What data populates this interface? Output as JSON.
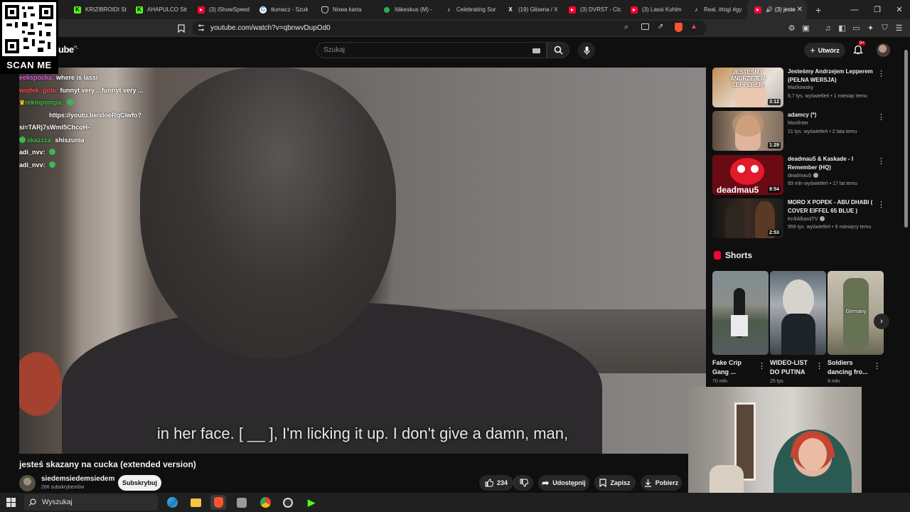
{
  "tabs": [
    {
      "label": "KRIZIBROIDI St",
      "color": "#53fc18"
    },
    {
      "label": "AHAPULCO Str",
      "color": "#53fc18"
    },
    {
      "label": "(3) iShowSpeed",
      "color": "#ff0033"
    },
    {
      "label": "tłumacz - Szuk",
      "color": "#dddddd"
    },
    {
      "label": "Nowa karta",
      "color": "#dddddd"
    },
    {
      "label": "Itäkeskus (M) -",
      "color": "#34a853"
    },
    {
      "label": "Celebrating Sor",
      "color": "#dddddd"
    },
    {
      "label": "(19) Główna / X",
      "color": "#dddddd"
    },
    {
      "label": "(3) DVRST - Clc",
      "color": "#ff0033"
    },
    {
      "label": "(3) Lassi Kuhlm",
      "color": "#ff0033"
    },
    {
      "label": "Real. #togi #gy",
      "color": "#dddddd"
    },
    {
      "label": "(3) jeste",
      "color": "#ff0033"
    }
  ],
  "address": {
    "url": "youtube.com/watch?v=qbnwvDupOd0"
  },
  "qr": {
    "label": "SCAN ME"
  },
  "header": {
    "logo": "ube",
    "region": "PL",
    "search_placeholder": "Szukaj",
    "create_label": "Utwórz",
    "notif_count": "9+"
  },
  "chat": [
    {
      "user": "eekspocka:",
      "text": "where is lassi",
      "color": "#e05bd9"
    },
    {
      "user": "wojtek_gola:",
      "text": "funnyt very ...funnyt very ...",
      "color": "#ff4a4a"
    },
    {
      "user": "rekinpompa:",
      "text": "",
      "color": "#41c440"
    },
    {
      "user": "",
      "text": "https://youtu.be/xloeRqCiwfo?",
      "color": "#ffffff"
    },
    {
      "user": "",
      "text": "si=TARj7sWmI5ChcoH-",
      "color": "#ffffff"
    },
    {
      "user": "skazzza:",
      "text": "shiszunia",
      "color": "#41c440"
    },
    {
      "user": "adi_nvv:",
      "text": "",
      "color": "#ffffff"
    },
    {
      "user": "adi_nvv:",
      "text": "",
      "color": "#ffffff"
    }
  ],
  "video": {
    "subtitle": "in her face. [ __ ], I'm licking it up. I don't give a damn, man,",
    "title": "jesteś skazany na cucka (extended version)"
  },
  "channel": {
    "name": "siedemsiedemsiedem",
    "subs": "266 subskrybentów",
    "subscribe_label": "Subskrybuj"
  },
  "actions": {
    "likes": "234",
    "share": "Udostępnij",
    "save": "Zapisz",
    "download": "Pobierz"
  },
  "recommendations": [
    {
      "title": "Jesteśmy Andrzejem Lepperem (PEŁNA WERSJA)",
      "channel": "Maćkowsky",
      "meta": "6,7 tys. wyświetleń • 1 miesiąc temu",
      "duration": "3:12",
      "verified": false,
      "thumb_text": "JESTEŚMY ANDRZEJEM LEPPEREM"
    },
    {
      "title": "adamcy (*)",
      "channel": "Monfinter",
      "meta": "21 tys. wyświetleń • 2 lata temu",
      "duration": "1:29",
      "verified": false
    },
    {
      "title": "deadmau5 & Kaskade - I Remember (HQ)",
      "channel": "deadmau5",
      "meta": "93 mln wyświetleń • 17 lat temu",
      "duration": "9:54",
      "verified": true,
      "thumb_text": "deadmau5"
    },
    {
      "title": "MORO X POPEK - ABU DHABI ( COVER EIFFEL 65 BLUE )",
      "channel": "KrólAlbaniiTV",
      "meta": "959 tys. wyświetleń • 9 miesięcy temu",
      "duration": "2:53",
      "verified": true
    }
  ],
  "shorts": {
    "heading": "Shorts",
    "items": [
      {
        "title": "Fake Crip Gang ...",
        "views": "70 mln"
      },
      {
        "title": "WIDEO-LIST DO PUTINA",
        "views": "25 tys."
      },
      {
        "title": "Soldiers dancing fro...",
        "views": "9 mln",
        "thumb_text": "Germany"
      }
    ]
  },
  "taskbar": {
    "search_label": "Wyszukaj"
  }
}
